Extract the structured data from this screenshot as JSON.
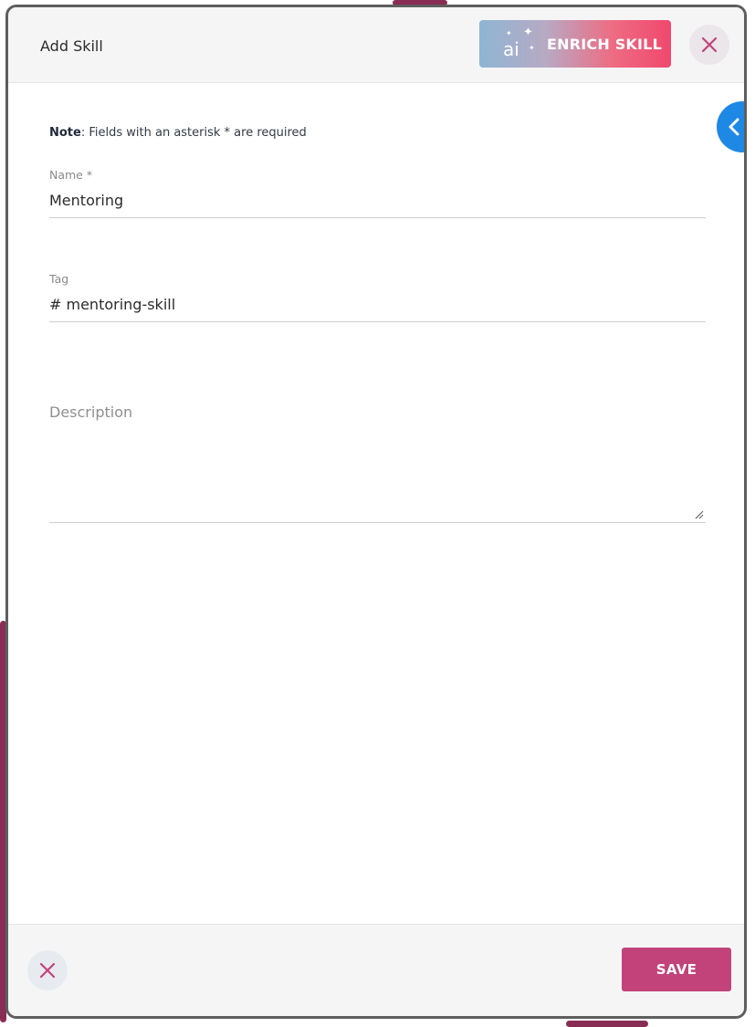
{
  "dialog": {
    "title": "Add Skill",
    "enrich_button": {
      "icon_text": "ai",
      "label": "ENRICH SKILL"
    },
    "close_icon": "close-icon",
    "side_tab_icon": "chevron-left-icon"
  },
  "form": {
    "note_bold": "Note",
    "note_text": ": Fields with an asterisk * are required",
    "name": {
      "label": "Name *",
      "value": "Mentoring"
    },
    "tag": {
      "label": "Tag",
      "value": "# mentoring-skill"
    },
    "description": {
      "placeholder": "Description"
    }
  },
  "footer": {
    "cancel_icon": "close-icon",
    "save_label": "SAVE"
  },
  "colors": {
    "accent": "#c2437a",
    "side_tab": "#1e88e5"
  }
}
